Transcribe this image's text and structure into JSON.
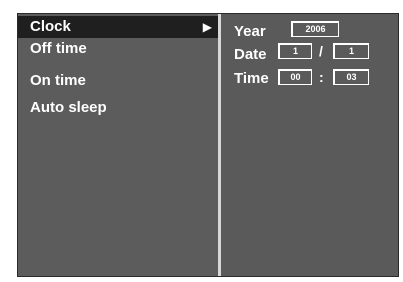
{
  "menu": {
    "items": [
      {
        "label": "Clock",
        "selected": true,
        "arrow": "▶"
      },
      {
        "label": "Off time",
        "selected": false
      },
      {
        "label": "On time",
        "selected": false
      },
      {
        "label": "Auto sleep",
        "selected": false
      }
    ]
  },
  "clock": {
    "year_label": "Year",
    "year_value": "2006",
    "date_label": "Date",
    "date_month": "1",
    "date_separator": "/",
    "date_day": "1",
    "time_label": "Time",
    "time_hour": "00",
    "time_separator": ":",
    "time_minute": "03"
  }
}
